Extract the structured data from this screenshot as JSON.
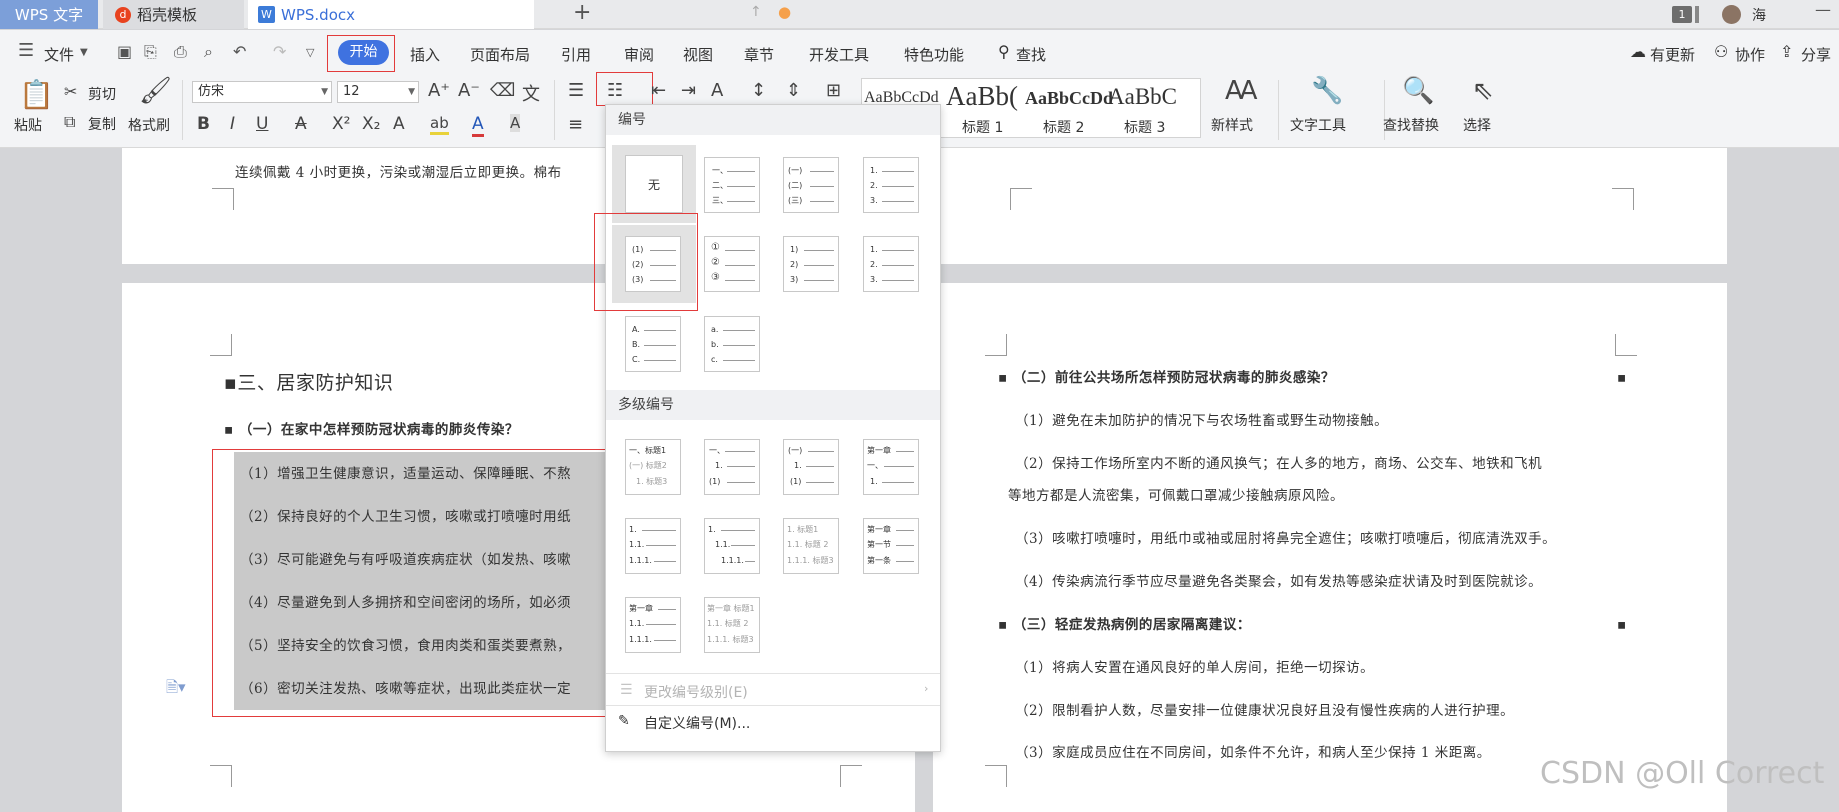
{
  "tabs": {
    "app": "WPS 文字",
    "template": "稻壳模板",
    "document": "WPS.docx",
    "template_icon": "daoke-icon",
    "doc_icon": "w-icon"
  },
  "titlebar": {
    "badge": "1",
    "user": "海"
  },
  "menu": {
    "file": "文件",
    "items": [
      "开始",
      "插入",
      "页面布局",
      "引用",
      "审阅",
      "视图",
      "章节",
      "开发工具",
      "特色功能",
      "查找"
    ],
    "update": "有更新",
    "collab": "协作",
    "share": "分享"
  },
  "ribbon": {
    "paste": "粘贴",
    "cut": "剪切",
    "copy": "复制",
    "format_painter": "格式刷",
    "font_name": "仿宋",
    "font_size": "12",
    "styles": [
      {
        "preview": "AaBbCcDd",
        "label": ""
      },
      {
        "preview": "AaBb(",
        "label": "标题 1"
      },
      {
        "preview": "AaBbCcDd",
        "label": "标题 2"
      },
      {
        "preview": "AaBbC",
        "label": "标题 3"
      }
    ],
    "new_style": "新样式",
    "text_tools": "文字工具",
    "find_replace": "查找替换",
    "select": "选择"
  },
  "doc": {
    "top_line": "连续佩戴 4 小时更换，污染或潮湿后立即更换。棉布",
    "heading3": "三、居家防护知识",
    "sub1": "（一）在家中怎样预防冠状病毒的肺炎传染？",
    "left_items": [
      "（1）增强卫生健康意识，适量运动、保障睡眠、不熬",
      "（2）保持良好的个人卫生习惯，咳嗽或打喷嚏时用纸",
      "（3）尽可能避免与有呼吸道疾病症状（如发热、咳嗽",
      "（4）尽量避免到人多拥挤和空间密闭的场所，如必须",
      "（5）坚持安全的饮食习惯，食用肉类和蛋类要煮熟，",
      "（6）密切关注发热、咳嗽等症状，出现此类症状一定"
    ],
    "sub2": "（二）前往公共场所怎样预防冠状病毒的肺炎感染？",
    "right_items": [
      "（1）避免在未加防护的情况下与农场牲畜或野生动物接触。",
      "（2）保持工作场所室内不断的通风换气；在人多的地方，商场、公交车、地铁和飞机",
      "等地方都是人流密集，可佩戴口罩减少接触病原风险。",
      "（3）咳嗽打喷嚏时，用纸巾或袖或屈肘将鼻完全遮住；咳嗽打喷嚏后，彻底清洗双手。",
      "（4）传染病流行季节应尽量避免各类聚会，如有发热等感染症状请及时到医院就诊。"
    ],
    "sub3": "（三）轻症发热病例的居家隔离建议：",
    "right_items2": [
      "（1）将病人安置在通风良好的单人房间，拒绝一切探访。",
      "（2）限制看护人数，尽量安排一位健康状况良好且没有慢性疾病的人进行护理。",
      "（3）家庭成员应住在不同房间，如条件不允许，和病人至少保持 1 米距离。"
    ]
  },
  "dropdown": {
    "numbering_title": "编号",
    "multilevel_title": "多级编号",
    "none_label": "无",
    "numbering_rows": [
      [
        [
          "一、",
          "二、",
          "三、"
        ],
        [
          "(一)",
          "(二)",
          "(三)"
        ],
        [
          "1.",
          "2.",
          "3."
        ]
      ],
      [
        [
          "(1)",
          "(2)",
          "(3)"
        ],
        [
          "①",
          "②",
          "③"
        ],
        [
          "1)",
          "2)",
          "3)"
        ],
        [
          "1.",
          "2.",
          "3."
        ]
      ],
      [
        [
          "A.",
          "B.",
          "C."
        ],
        [
          "a.",
          "b.",
          "c."
        ]
      ]
    ],
    "multilevel_rows": [
      [
        [
          "一、标题1",
          "(一) 标题2",
          "1. 标题3"
        ],
        [
          "一、",
          "1.",
          "(1)"
        ],
        [
          "(一)",
          "1.",
          "(1)"
        ],
        [
          "第一章",
          "一、",
          "1."
        ]
      ],
      [
        [
          "1.",
          "1.1.",
          "1.1.1."
        ],
        [
          "1.",
          "1.1.",
          "1.1.1."
        ],
        [
          "1. 标题1",
          "1.1. 标题 2",
          "1.1.1. 标题3"
        ],
        [
          "第一章",
          "第一节",
          "第一条"
        ]
      ],
      [
        [
          "第一章",
          "1.1.",
          "1.1.1."
        ],
        [
          "第一章 标题1",
          "1.1. 标题 2",
          "1.1.1. 标题3"
        ]
      ]
    ],
    "change_level": "更改编号级别(E)",
    "custom": "自定义编号(M)..."
  },
  "watermark": "CSDN @Oll Correct"
}
